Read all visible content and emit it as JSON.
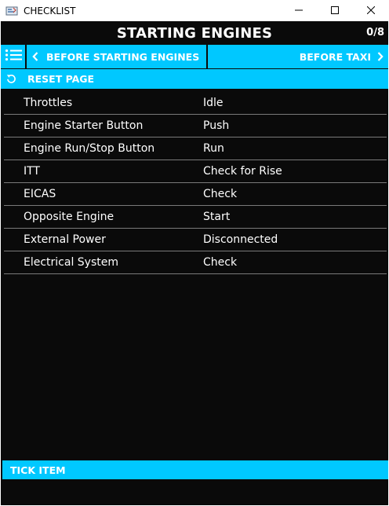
{
  "window": {
    "title": "CHECKLIST"
  },
  "header": {
    "title": "STARTING ENGINES",
    "counter": "0/8"
  },
  "nav": {
    "prev_label": "BEFORE STARTING ENGINES",
    "next_label": "BEFORE TAXI"
  },
  "reset": {
    "label": "RESET PAGE"
  },
  "checklist": {
    "items": [
      {
        "name": "Throttles",
        "action": "Idle"
      },
      {
        "name": "Engine Starter Button",
        "action": "Push"
      },
      {
        "name": "Engine Run/Stop Button",
        "action": "Run"
      },
      {
        "name": "ITT",
        "action": "Check for Rise"
      },
      {
        "name": "EICAS",
        "action": "Check"
      },
      {
        "name": "Opposite Engine",
        "action": "Start"
      },
      {
        "name": "External Power",
        "action": "Disconnected"
      },
      {
        "name": "Electrical System",
        "action": "Check"
      }
    ]
  },
  "footer": {
    "tick_label": "TICK ITEM"
  },
  "colors": {
    "accent": "#00c8ff",
    "background": "#0a0a0a",
    "text": "#ffffff",
    "divider": "#7a7a7a"
  },
  "icons": {
    "app": "checklist-app-icon",
    "menu": "list-icon",
    "prev": "chevron-left-icon",
    "next": "chevron-right-icon",
    "reset": "refresh-icon",
    "minimize": "minimize-icon",
    "maximize": "maximize-icon",
    "close": "close-icon"
  }
}
